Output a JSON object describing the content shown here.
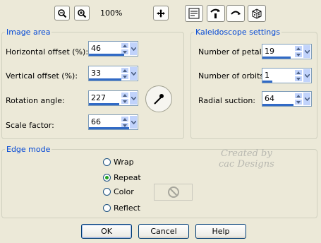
{
  "toolbar": {
    "zoom_percent": "100%",
    "icons": [
      "zoom-out-icon",
      "zoom-in-icon",
      "pan-icon",
      "preview-icon",
      "randomize-params-icon",
      "reset-icon",
      "dice-icon"
    ]
  },
  "image_area": {
    "title": "Image area",
    "horizontal_offset": {
      "label": "Horizontal offset (%):",
      "value": "46",
      "level": 0.73
    },
    "vertical_offset": {
      "label": "Vertical offset (%):",
      "value": "33",
      "level": 0.66
    },
    "rotation_angle": {
      "label": "Rotation angle:",
      "value": "227",
      "level": 0.63
    },
    "scale_factor": {
      "label": "Scale factor:",
      "value": "66",
      "level": 0.83
    }
  },
  "kaleidoscope": {
    "title": "Kaleidoscope settings",
    "number_of_petals": {
      "label": "Number of petals:",
      "value": "19",
      "level": 0.58
    },
    "number_of_orbits": {
      "label": "Number of orbits:",
      "value": "1",
      "level": 0.2
    },
    "radial_suction": {
      "label": "Radial suction:",
      "value": "64",
      "level": 0.64
    }
  },
  "edge_mode": {
    "title": "Edge mode",
    "options": [
      "Wrap",
      "Repeat",
      "Color",
      "Reflect"
    ],
    "selected": "Repeat"
  },
  "watermark": {
    "line1": "Created by",
    "line2": "cac Designs"
  },
  "buttons": {
    "ok": "OK",
    "cancel": "Cancel",
    "help": "Help"
  },
  "colors": {
    "accent": "#316ac5",
    "group_title": "#0046d5",
    "background": "#ece9d8"
  }
}
